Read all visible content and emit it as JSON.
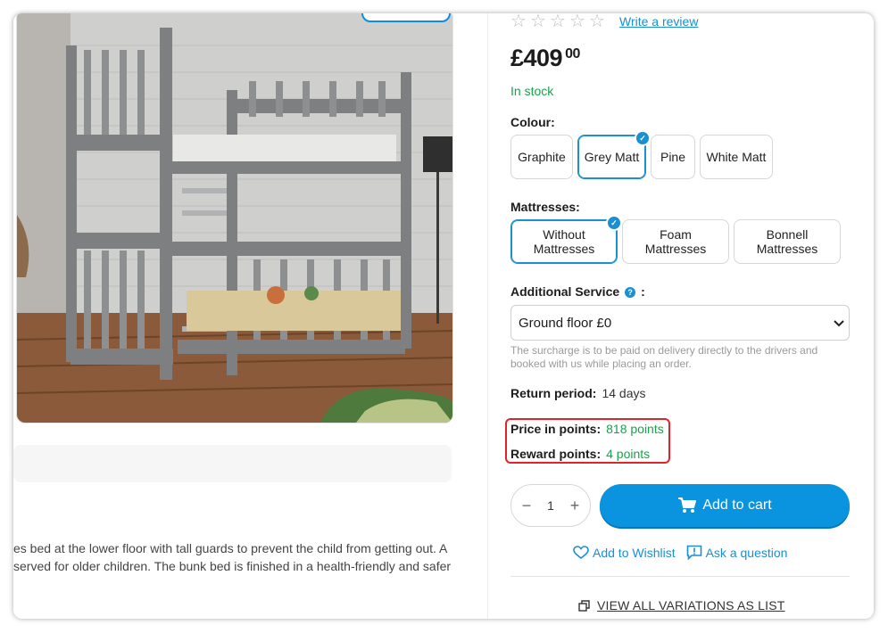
{
  "rating": {
    "stars": 5,
    "filled": 0,
    "write_review": "Write a review"
  },
  "price": {
    "main": "£409",
    "cents": "00"
  },
  "stock": "In stock",
  "colour": {
    "label": "Colour:",
    "options": [
      "Graphite",
      "Grey Matt",
      "Pine",
      "White Matt"
    ],
    "selected": "Grey Matt"
  },
  "mattresses": {
    "label": "Mattresses:",
    "options": [
      "Without Mattresses",
      "Foam Mattresses",
      "Bonnell Mattresses"
    ],
    "selected": "Without Mattresses"
  },
  "service": {
    "label": "Additional Service",
    "colon": ":",
    "selected": "Ground floor £0",
    "note": "The surcharge is to be paid on delivery directly to the drivers and booked with us while placing an order."
  },
  "return_period": {
    "label": "Return period:",
    "value": "14 days"
  },
  "points": {
    "price_label": "Price in points:",
    "price_value": "818 points",
    "reward_label": "Reward points:",
    "reward_value": "4 points"
  },
  "quantity": {
    "minus": "−",
    "value": "1",
    "plus": "+"
  },
  "cart": {
    "label": "Add to cart"
  },
  "actions": {
    "wishlist": "Add to Wishlist",
    "question": "Ask a question"
  },
  "variations_link": "VIEW ALL VARIATIONS AS LIST",
  "description": {
    "line1": "es bed at the lower floor with tall guards to prevent the child from getting out. A",
    "line2": "served for older children. The bunk bed is finished in a health-friendly and safer"
  },
  "colors": {
    "accent": "#0a93df",
    "green": "#17a34a",
    "highlight": "#e0242b"
  }
}
